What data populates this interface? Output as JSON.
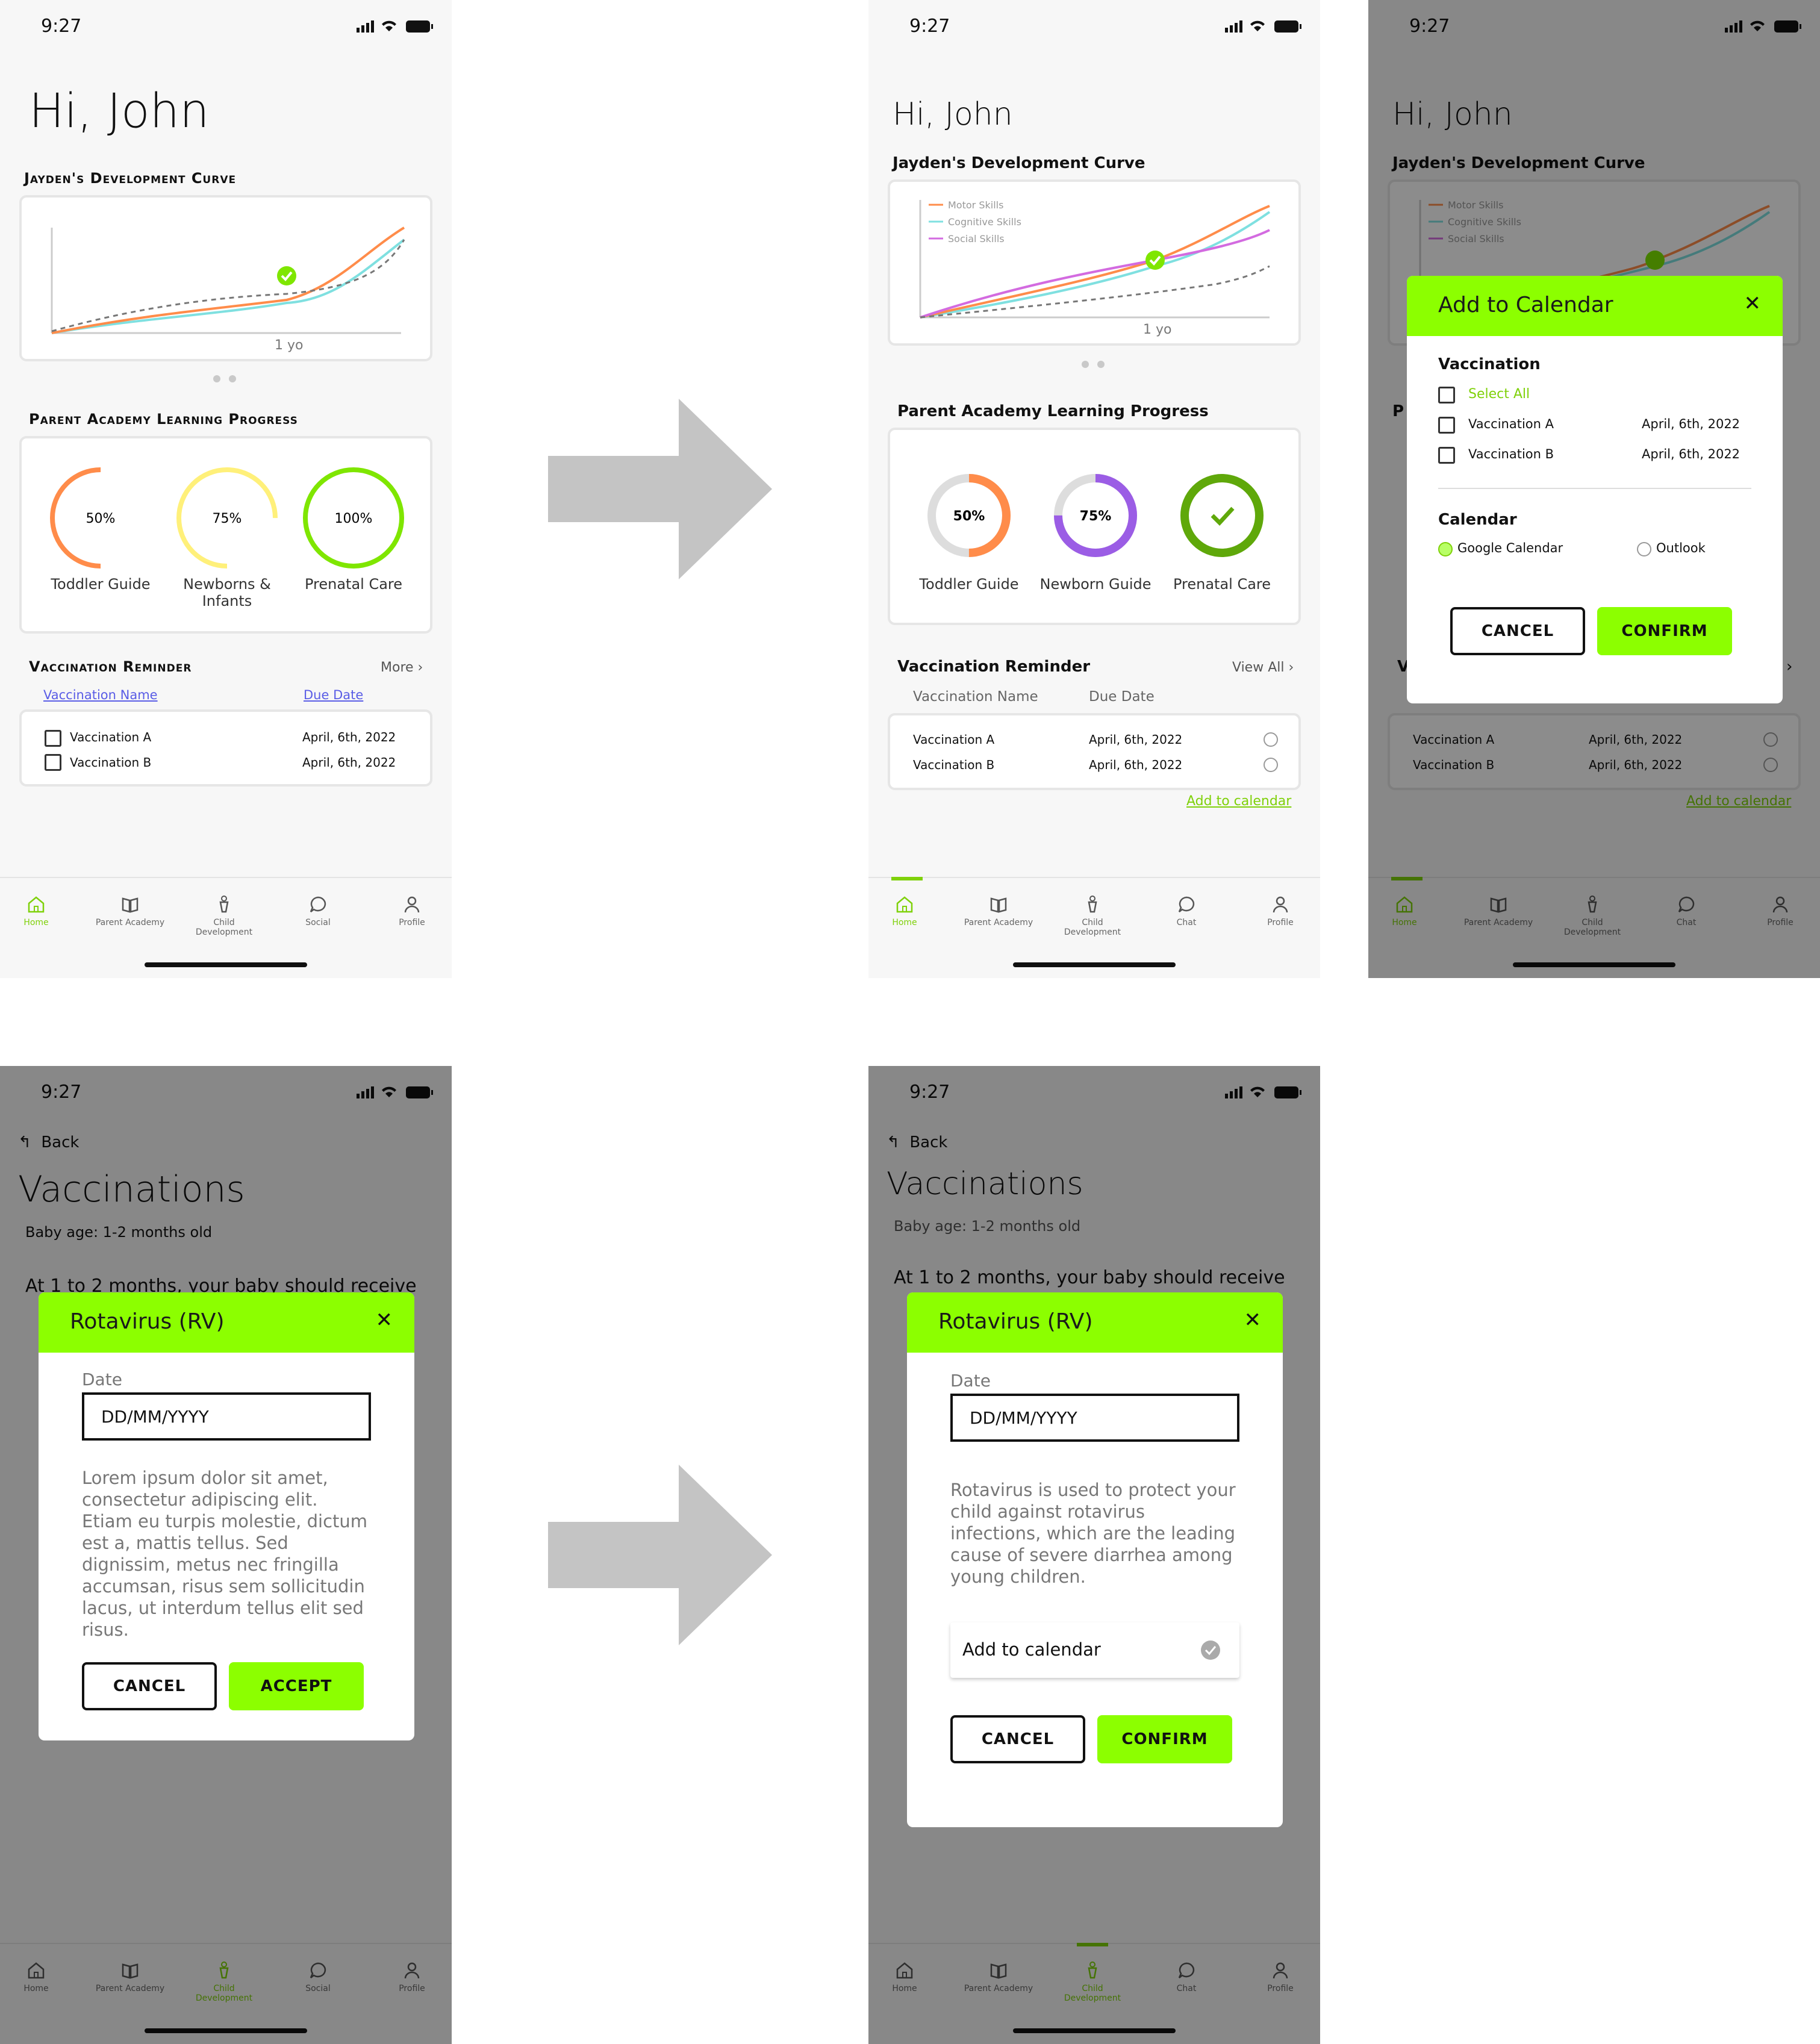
{
  "status": {
    "time": "9:27"
  },
  "s1": {
    "greeting": "Hi, John",
    "curve_title": "Jayden's Development Curve",
    "curve_xlabel": "1 yo",
    "progress_title": "Parent Academy Learning Progress",
    "rings": [
      {
        "value": "50%",
        "label": "Toddler Guide",
        "color": "#ff8c4a",
        "fraction": 0.5
      },
      {
        "value": "75%",
        "label": "Newborns & Infants",
        "color": "#fff07a",
        "fraction": 0.75
      },
      {
        "value": "100%",
        "label": "Prenatal Care",
        "color": "#7fe600",
        "fraction": 1.0
      }
    ],
    "vacc_title": "Vaccination Reminder",
    "more": "More",
    "col_name": "Vaccination Name",
    "col_due": "Due Date",
    "rows": [
      {
        "name": "Vaccination A",
        "date": "April, 6th, 2022"
      },
      {
        "name": "Vaccination B",
        "date": "April, 6th, 2022"
      }
    ]
  },
  "s2": {
    "greeting": "Hi, John",
    "curve_title": "Jayden's Development Curve",
    "legend": [
      "Motor Skills",
      "Cognitive Skills",
      "Social Skills"
    ],
    "legend_colors": [
      "#ff8c4a",
      "#7fe0e0",
      "#d36be0"
    ],
    "curve_xlabel": "1 yo",
    "progress_title": "Parent Academy Learning Progress",
    "rings": [
      {
        "value": "50%",
        "label": "Toddler Guide",
        "color": "#ff8c4a",
        "fraction": 0.5
      },
      {
        "value": "75%",
        "label": "Newborn Guide",
        "color": "#9b5de5",
        "fraction": 0.75
      },
      {
        "value": "",
        "label": "Prenatal Care",
        "color": "#5fa80a",
        "fraction": 1.0
      }
    ],
    "vacc_title": "Vaccination Reminder",
    "view_all": "View All",
    "col_name": "Vaccination Name",
    "col_due": "Due Date",
    "rows": [
      {
        "name": "Vaccination A",
        "date": "April, 6th, 2022"
      },
      {
        "name": "Vaccination B",
        "date": "April, 6th, 2022"
      }
    ],
    "add_calendar": "Add to calendar"
  },
  "s3": {
    "modal_title": "Add to Calendar",
    "vacc_label": "Vaccination",
    "select_all": "Select All",
    "rows": [
      {
        "name": "Vaccination A",
        "date": "April, 6th, 2022"
      },
      {
        "name": "Vaccination B",
        "date": "April, 6th, 2022"
      }
    ],
    "calendar_label": "Calendar",
    "google": "Google Calendar",
    "outlook": "Outlook",
    "cancel": "CANCEL",
    "confirm": "CONFIRM"
  },
  "s4": {
    "back": "Back",
    "title": "Vaccinations",
    "age": "Baby age: 1-2 months old",
    "intro": "At 1 to 2 months, your baby should receive",
    "modal_title": "Rotavirus (RV)",
    "date_label": "Date",
    "date_placeholder": "DD/MM/YYYY",
    "body": "Lorem ipsum dolor sit amet, consectetur adipiscing elit. Etiam eu turpis molestie, dictum est a, mattis tellus. Sed dignissim, metus nec fringilla accumsan, risus sem sollicitudin lacus, ut interdum tellus elit sed risus.",
    "cancel": "CANCEL",
    "accept": "ACCEPT"
  },
  "s5": {
    "back": "Back",
    "title": "Vaccinations",
    "age": "Baby age: 1-2 months old",
    "intro": "At 1 to 2 months, your baby should receive",
    "modal_title": "Rotavirus (RV)",
    "date_label": "Date",
    "date_placeholder": "DD/MM/YYYY",
    "body": "Rotavirus is used to protect your child against rotavirus infections, which are the leading cause of severe diarrhea among young children.",
    "add_calendar": "Add to calendar",
    "cancel": "CANCEL",
    "confirm": "CONFIRM"
  },
  "tabs1": [
    "Home",
    "Parent Academy",
    "Child Development",
    "Social",
    "Profile"
  ],
  "tabs2": [
    "Home",
    "Parent Academy",
    "Child Development",
    "Chat",
    "Profile"
  ],
  "colors": {
    "accent": "#8cff00",
    "active_tab": "#7fd10a"
  }
}
